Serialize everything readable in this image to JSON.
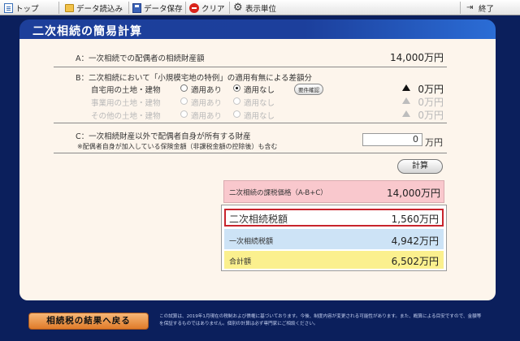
{
  "toolbar": {
    "top": "トップ",
    "load": "データ読込み",
    "save": "データ保存",
    "clear": "クリア",
    "units": "表示単位",
    "exit": "終了"
  },
  "title": "二次相続の簡易計算",
  "section_a": {
    "label": "A：一次相続での配偶者の相続財産額",
    "value": "14,000万円"
  },
  "section_b": {
    "label": "B：二次相続において「小規模宅地の特例」の適用有無による差額分",
    "rows": [
      {
        "label": "自宅用の土地・建物",
        "opt1": "適用あり",
        "opt2": "適用なし",
        "value": "0万円",
        "selected": "opt2"
      },
      {
        "label": "事業用の土地・建物",
        "opt1": "適用あり",
        "opt2": "適用なし",
        "value": "0万円",
        "selected": "none"
      },
      {
        "label": "その他の土地・建物",
        "opt1": "適用あり",
        "opt2": "適用なし",
        "value": "0万円",
        "selected": "none"
      }
    ],
    "req_button": "要件確認"
  },
  "section_c": {
    "label": "C：一次相続財産以外で配偶者自身が所有する財産",
    "note": "※配偶者自身が加入している保険金額（非課税金額の控除後）も含む",
    "value": "0",
    "unit": "万円"
  },
  "calc_button": "計算",
  "results": {
    "taxable_label": "二次相続の課税価格（A-B+C）",
    "taxable_value": "14,000万円",
    "second_tax_label": "二次相続税額",
    "second_tax_value": "1,560万円",
    "first_tax_label": "一次相続税額",
    "first_tax_value": "4,942万円",
    "total_label": "合計額",
    "total_value": "6,502万円"
  },
  "footer": {
    "back_button": "相続税の結果へ戻る",
    "note": "この試算は、2019年1月現在の税制および債権に基づいております。今後、制度内容が変更される可能性があります。また、概算による目安ですので、金額等を保証するものではありません。個別の計算は必ず専門家にご相談ください。"
  },
  "colors": {
    "background": "#0b1f5c",
    "title_bar": "#1d3f9a",
    "panel": "#fdf5ec",
    "taxable_bg": "#f9c8cd",
    "first_tax_bg": "#cde3f6",
    "total_bg": "#fbf08e",
    "highlight_border": "#c8242c",
    "back_button": "#e88a3a"
  },
  "icons": {
    "top": "document-icon",
    "load": "folder-icon",
    "save": "floppy-icon",
    "clear": "clear-icon",
    "units": "gear-icon",
    "exit": "exit-icon"
  }
}
